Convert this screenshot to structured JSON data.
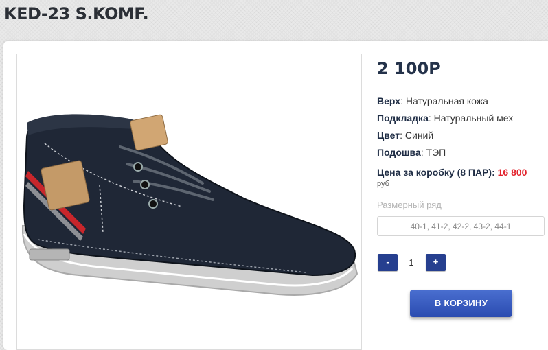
{
  "product": {
    "title": "KED-23 S.KOMF.",
    "price": "2 100Р",
    "image_icon": "shoe-icon"
  },
  "specs": {
    "upper_label": "Верх",
    "upper_value": ": Натуральная кожа",
    "lining_label": "Подкладка",
    "lining_value": ": Натуральный мех",
    "color_label": "Цвет",
    "color_value": ": Синий",
    "sole_label": "Подошва",
    "sole_value": ": ТЭП"
  },
  "box": {
    "label": "Цена за коробку (8 ПАР):",
    "price": "16 800",
    "currency": "руб"
  },
  "sizes": {
    "label": "Размерный ряд",
    "selected": "40-1, 41-2, 42-2, 43-2, 44-1"
  },
  "quantity": {
    "minus_label": "-",
    "value": "1",
    "plus_label": "+"
  },
  "cart": {
    "label": "В КОРЗИНУ"
  },
  "colors": {
    "accent": "#263f8f",
    "price_red": "#e2232d",
    "heading": "#24324a"
  }
}
